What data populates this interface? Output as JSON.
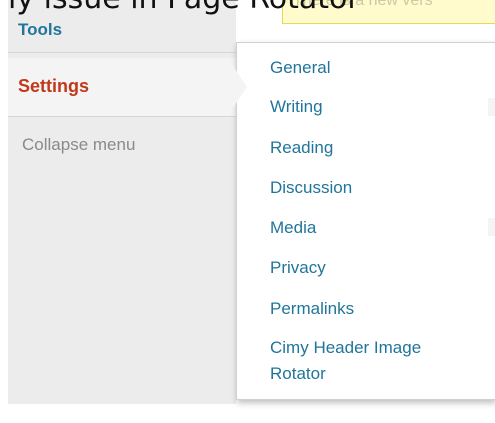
{
  "page": {
    "caption": "ly issue in Page Rotator"
  },
  "notice": {
    "text": "There is a new vers"
  },
  "admin_menu": {
    "tools_label": "Tools",
    "settings_label": "Settings",
    "collapse_label": "Collapse menu"
  },
  "settings_submenu": {
    "items": [
      "General",
      "Writing",
      "Reading",
      "Discussion",
      "Media",
      "Privacy",
      "Permalinks",
      "Cimy Header Image Rotator"
    ]
  },
  "colors": {
    "menu_background": "#ececec",
    "link_blue": "#21759b",
    "current_red": "#c0391b",
    "muted_gray": "#8a8a8a",
    "notice_yellow": "#fffbcc"
  }
}
